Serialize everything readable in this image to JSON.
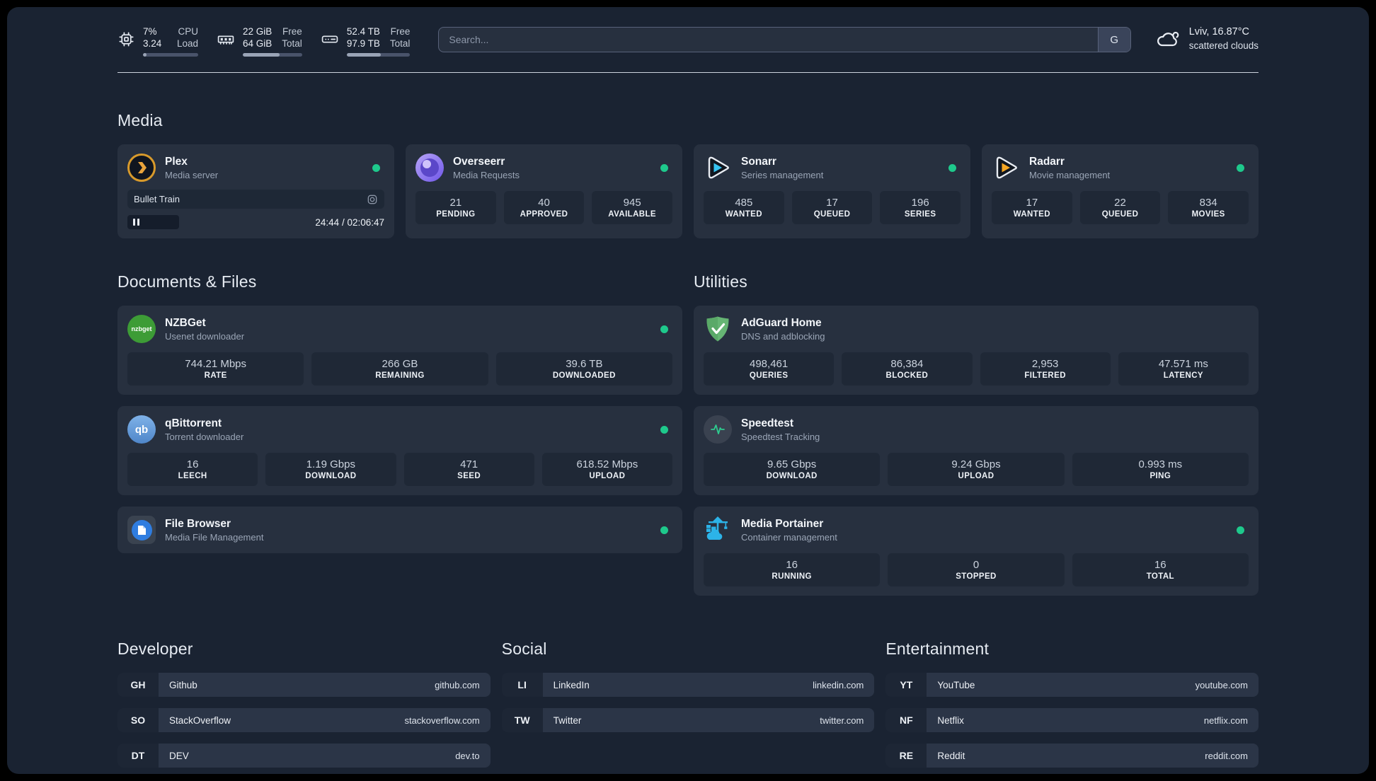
{
  "colors": {
    "status_online": "#1ec98c",
    "accent_plex": "#e5a00d",
    "accent_sonarr": "#36c3f1",
    "accent_radarr": "#f5a623"
  },
  "topbar": {
    "cpu": {
      "icon": "cpu-icon",
      "v1": "7%",
      "l1": "CPU",
      "v2": "3.24",
      "l2": "Load",
      "progress": 7
    },
    "memory": {
      "icon": "memory-icon",
      "v1": "22 GiB",
      "l1": "Free",
      "v2": "64 GiB",
      "l2": "Total",
      "progress": 62
    },
    "disk": {
      "icon": "disk-icon",
      "v1": "52.4 TB",
      "l1": "Free",
      "v2": "97.9 TB",
      "l2": "Total",
      "progress": 54
    },
    "search": {
      "placeholder": "Search...",
      "button_label": "G"
    },
    "weather": {
      "icon": "cloud-icon",
      "location": "Lviv, 16.87°C",
      "condition": "scattered clouds"
    }
  },
  "media": {
    "title": "Media",
    "plex": {
      "name": "Plex",
      "subtitle": "Media server",
      "online": true,
      "now_playing": "Bullet Train",
      "time": "24:44 / 02:06:47"
    },
    "overseerr": {
      "name": "Overseerr",
      "subtitle": "Media Requests",
      "online": true,
      "stats": [
        {
          "value": "21",
          "label": "PENDING"
        },
        {
          "value": "40",
          "label": "APPROVED"
        },
        {
          "value": "945",
          "label": "AVAILABLE"
        }
      ]
    },
    "sonarr": {
      "name": "Sonarr",
      "subtitle": "Series management",
      "online": true,
      "stats": [
        {
          "value": "485",
          "label": "WANTED"
        },
        {
          "value": "17",
          "label": "QUEUED"
        },
        {
          "value": "196",
          "label": "SERIES"
        }
      ]
    },
    "radarr": {
      "name": "Radarr",
      "subtitle": "Movie management",
      "online": true,
      "stats": [
        {
          "value": "17",
          "label": "WANTED"
        },
        {
          "value": "22",
          "label": "QUEUED"
        },
        {
          "value": "834",
          "label": "MOVIES"
        }
      ]
    }
  },
  "documents": {
    "title": "Documents & Files",
    "nzbget": {
      "name": "NZBGet",
      "subtitle": "Usenet downloader",
      "online": true,
      "badge_text": "nzbget",
      "stats": [
        {
          "value": "744.21 Mbps",
          "label": "RATE"
        },
        {
          "value": "266 GB",
          "label": "REMAINING"
        },
        {
          "value": "39.6 TB",
          "label": "DOWNLOADED"
        }
      ]
    },
    "qbittorrent": {
      "name": "qBittorrent",
      "subtitle": "Torrent downloader",
      "online": true,
      "badge_text": "qb",
      "stats": [
        {
          "value": "16",
          "label": "LEECH"
        },
        {
          "value": "1.19 Gbps",
          "label": "DOWNLOAD"
        },
        {
          "value": "471",
          "label": "SEED"
        },
        {
          "value": "618.52 Mbps",
          "label": "UPLOAD"
        }
      ]
    },
    "filebrowser": {
      "name": "File Browser",
      "subtitle": "Media File Management",
      "online": true
    }
  },
  "utilities": {
    "title": "Utilities",
    "adguard": {
      "name": "AdGuard Home",
      "subtitle": "DNS and adblocking",
      "stats": [
        {
          "value": "498,461",
          "label": "QUERIES"
        },
        {
          "value": "86,384",
          "label": "BLOCKED"
        },
        {
          "value": "2,953",
          "label": "FILTERED"
        },
        {
          "value": "47.571 ms",
          "label": "LATENCY"
        }
      ]
    },
    "speedtest": {
      "name": "Speedtest",
      "subtitle": "Speedtest Tracking",
      "stats": [
        {
          "value": "9.65 Gbps",
          "label": "DOWNLOAD"
        },
        {
          "value": "9.24 Gbps",
          "label": "UPLOAD"
        },
        {
          "value": "0.993 ms",
          "label": "PING"
        }
      ]
    },
    "portainer": {
      "name": "Media Portainer",
      "subtitle": "Container management",
      "online": true,
      "stats": [
        {
          "value": "16",
          "label": "RUNNING"
        },
        {
          "value": "0",
          "label": "STOPPED"
        },
        {
          "value": "16",
          "label": "TOTAL"
        }
      ]
    }
  },
  "links": {
    "developer": {
      "title": "Developer",
      "items": [
        {
          "abbr": "GH",
          "name": "Github",
          "url": "github.com"
        },
        {
          "abbr": "SO",
          "name": "StackOverflow",
          "url": "stackoverflow.com"
        },
        {
          "abbr": "DT",
          "name": "DEV",
          "url": "dev.to"
        }
      ]
    },
    "social": {
      "title": "Social",
      "items": [
        {
          "abbr": "LI",
          "name": "LinkedIn",
          "url": "linkedin.com"
        },
        {
          "abbr": "TW",
          "name": "Twitter",
          "url": "twitter.com"
        }
      ]
    },
    "entertainment": {
      "title": "Entertainment",
      "items": [
        {
          "abbr": "YT",
          "name": "YouTube",
          "url": "youtube.com"
        },
        {
          "abbr": "NF",
          "name": "Netflix",
          "url": "netflix.com"
        },
        {
          "abbr": "RE",
          "name": "Reddit",
          "url": "reddit.com"
        }
      ]
    }
  }
}
